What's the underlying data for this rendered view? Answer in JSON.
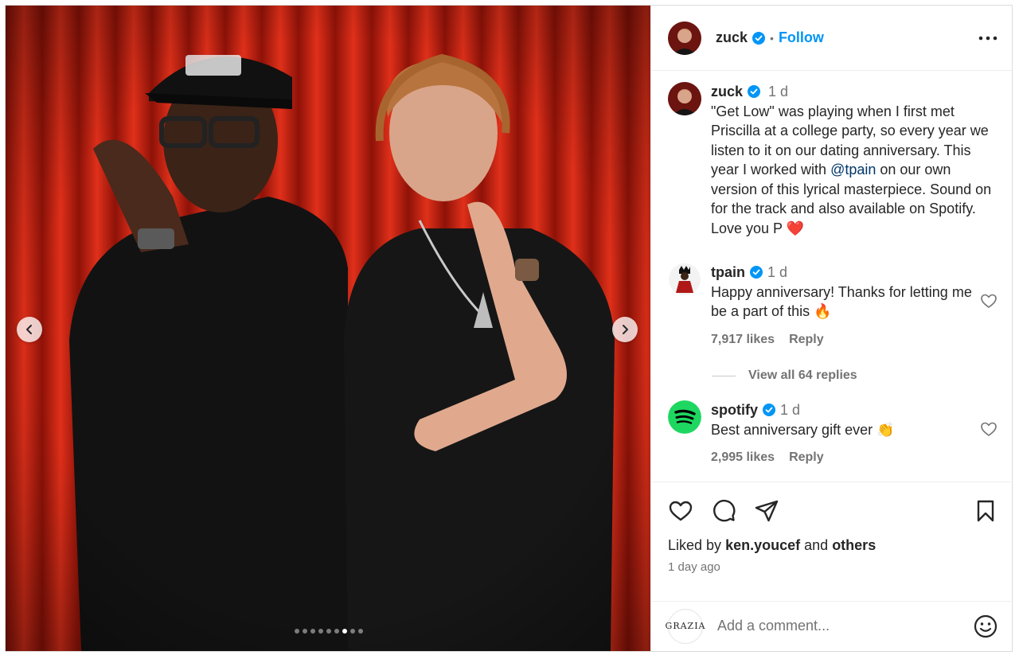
{
  "post": {
    "username": "zuck",
    "follow_label": "Follow",
    "separator": "•",
    "carousel": {
      "count": 9,
      "active_index": 6
    }
  },
  "caption": {
    "username": "zuck",
    "time": "1 d",
    "text_before": "\"Get Low\" was playing when I first met Priscilla at a college party, so every year we listen to it on our dating anniversary. This year I worked with ",
    "mention": "@tpain",
    "text_after": " on our own version of this lyrical masterpiece. Sound on for the track and also available on Spotify. Love you P ",
    "emoji": "❤️"
  },
  "comments": [
    {
      "username": "tpain",
      "time": "1 d",
      "text": "Happy anniversary! Thanks for letting me be a part of this ",
      "emoji": "🔥",
      "likes": "7,917 likes",
      "reply_label": "Reply",
      "view_replies": "View all 64 replies"
    },
    {
      "username": "spotify",
      "time": "1 d",
      "text": "Best anniversary gift ever ",
      "emoji": "👏",
      "likes": "2,995 likes",
      "reply_label": "Reply"
    }
  ],
  "likes": {
    "prefix": "Liked by",
    "user": "ken.youcef",
    "middle": "and",
    "others": "others",
    "time_ago": "1 day ago"
  },
  "add_comment": {
    "avatar_text": "GRAZIA",
    "placeholder": "Add a comment..."
  },
  "colors": {
    "accent": "#0095f6",
    "verified": "#0095f6",
    "spotify": "#1ed760",
    "curtain": "#c8200f"
  }
}
